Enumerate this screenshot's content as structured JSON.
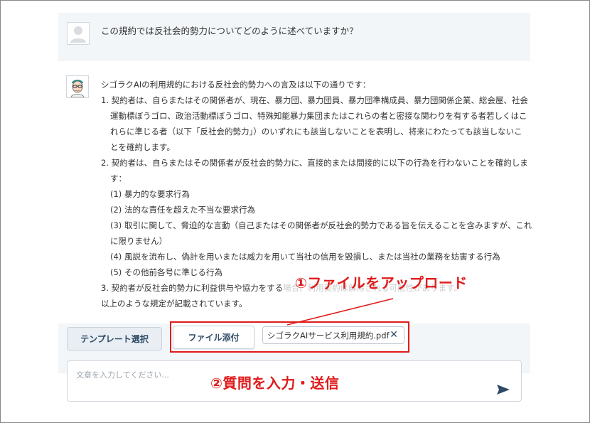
{
  "user_message": {
    "text": "この規約では反社会的勢力についてどのように述べていますか？"
  },
  "ai_message": {
    "intro": "シゴラクAIの利用規約における反社会的勢力への言及は以下の通りです：",
    "lines": [
      "1. 契約者は、自らまたはその関係者が、現在、暴力団、暴力団員、暴力団準構成員、暴力団関係企業、総会屋、社会",
      "運動標ぼうゴロ、政治活動標ぼうゴロ、特殊知能暴力集団またはこれらの者と密接な関わりを有する者若しくはこ",
      "れらに準じる者（以下「反社会的勢力」）のいずれにも該当しないことを表明し、将来にわたっても該当しないこ",
      "とを確約します。",
      "2. 契約者は、自らまたはその関係者が反社会的勢力に、直接的または間接的に以下の行為を行わないことを確約しま",
      "す：",
      "(1) 暴力的な要求行為",
      "(2) 法的な責任を超えた不当な要求行為",
      "(3) 取引に関して、脅迫的な言動（自己またはその関係者が反社会的勢力である旨を伝えることを含みますが、これ",
      "に限りません）",
      "(4) 風説を流布し、偽計を用いまたは威力を用いて当社の信用を毀損し、または当社の業務を妨害する行為",
      "(5) その他前各号に準じる行為"
    ],
    "line3_visible": "3. 契約者が反社会的勢力に利益供与や協力をする",
    "line3_faded": "場合、利用契約は解除される可能性があります。",
    "closing": "以上のような規定が記載されています。"
  },
  "toolbar": {
    "template_label": "テンプレート選択",
    "file_attach_label": "ファイル添付",
    "attached_file": "シゴラクAIサービス利用規約.pdf",
    "close_glyph": "✕"
  },
  "input": {
    "placeholder": "文章を入力してください..."
  },
  "annotations": {
    "step1": "①ファイルをアップロード",
    "step2": "②質問を入力・送信"
  },
  "colors": {
    "annotation_red": "#e01b1b",
    "button_text": "#2f4a66",
    "message_bg": "#f3f6f8"
  }
}
